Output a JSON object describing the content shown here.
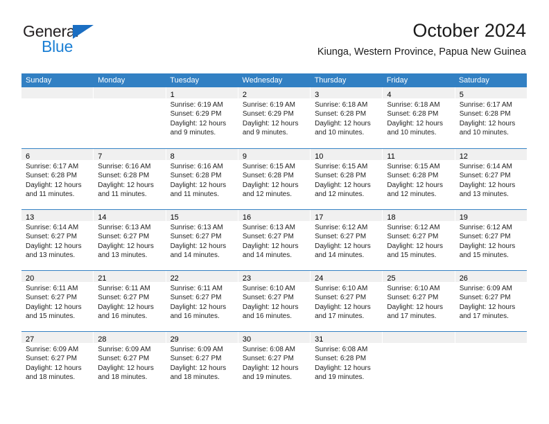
{
  "brand": {
    "name_top": "General",
    "name_bottom": "Blue",
    "triangle_icon": "triangle-icon",
    "color_dark": "#231f20",
    "color_blue": "#1b7fd4"
  },
  "header": {
    "title": "October 2024",
    "subtitle": "Kiunga, Western Province, Papua New Guinea"
  },
  "theme": {
    "header_bg": "#3280c3",
    "header_text": "#ffffff",
    "daynum_band": "#f0f0f0",
    "grid_line": "#3280c3"
  },
  "weekdays": [
    "Sunday",
    "Monday",
    "Tuesday",
    "Wednesday",
    "Thursday",
    "Friday",
    "Saturday"
  ],
  "weeks": [
    [
      {
        "day": "",
        "empty": true,
        "lines": []
      },
      {
        "day": "",
        "empty": true,
        "lines": []
      },
      {
        "day": "1",
        "lines": [
          "Sunrise: 6:19 AM",
          "Sunset: 6:29 PM",
          "Daylight: 12 hours",
          "and 9 minutes."
        ]
      },
      {
        "day": "2",
        "lines": [
          "Sunrise: 6:19 AM",
          "Sunset: 6:29 PM",
          "Daylight: 12 hours",
          "and 9 minutes."
        ]
      },
      {
        "day": "3",
        "lines": [
          "Sunrise: 6:18 AM",
          "Sunset: 6:28 PM",
          "Daylight: 12 hours",
          "and 10 minutes."
        ]
      },
      {
        "day": "4",
        "lines": [
          "Sunrise: 6:18 AM",
          "Sunset: 6:28 PM",
          "Daylight: 12 hours",
          "and 10 minutes."
        ]
      },
      {
        "day": "5",
        "lines": [
          "Sunrise: 6:17 AM",
          "Sunset: 6:28 PM",
          "Daylight: 12 hours",
          "and 10 minutes."
        ]
      }
    ],
    [
      {
        "day": "6",
        "lines": [
          "Sunrise: 6:17 AM",
          "Sunset: 6:28 PM",
          "Daylight: 12 hours",
          "and 11 minutes."
        ]
      },
      {
        "day": "7",
        "lines": [
          "Sunrise: 6:16 AM",
          "Sunset: 6:28 PM",
          "Daylight: 12 hours",
          "and 11 minutes."
        ]
      },
      {
        "day": "8",
        "lines": [
          "Sunrise: 6:16 AM",
          "Sunset: 6:28 PM",
          "Daylight: 12 hours",
          "and 11 minutes."
        ]
      },
      {
        "day": "9",
        "lines": [
          "Sunrise: 6:15 AM",
          "Sunset: 6:28 PM",
          "Daylight: 12 hours",
          "and 12 minutes."
        ]
      },
      {
        "day": "10",
        "lines": [
          "Sunrise: 6:15 AM",
          "Sunset: 6:28 PM",
          "Daylight: 12 hours",
          "and 12 minutes."
        ]
      },
      {
        "day": "11",
        "lines": [
          "Sunrise: 6:15 AM",
          "Sunset: 6:28 PM",
          "Daylight: 12 hours",
          "and 12 minutes."
        ]
      },
      {
        "day": "12",
        "lines": [
          "Sunrise: 6:14 AM",
          "Sunset: 6:27 PM",
          "Daylight: 12 hours",
          "and 13 minutes."
        ]
      }
    ],
    [
      {
        "day": "13",
        "lines": [
          "Sunrise: 6:14 AM",
          "Sunset: 6:27 PM",
          "Daylight: 12 hours",
          "and 13 minutes."
        ]
      },
      {
        "day": "14",
        "lines": [
          "Sunrise: 6:13 AM",
          "Sunset: 6:27 PM",
          "Daylight: 12 hours",
          "and 13 minutes."
        ]
      },
      {
        "day": "15",
        "lines": [
          "Sunrise: 6:13 AM",
          "Sunset: 6:27 PM",
          "Daylight: 12 hours",
          "and 14 minutes."
        ]
      },
      {
        "day": "16",
        "lines": [
          "Sunrise: 6:13 AM",
          "Sunset: 6:27 PM",
          "Daylight: 12 hours",
          "and 14 minutes."
        ]
      },
      {
        "day": "17",
        "lines": [
          "Sunrise: 6:12 AM",
          "Sunset: 6:27 PM",
          "Daylight: 12 hours",
          "and 14 minutes."
        ]
      },
      {
        "day": "18",
        "lines": [
          "Sunrise: 6:12 AM",
          "Sunset: 6:27 PM",
          "Daylight: 12 hours",
          "and 15 minutes."
        ]
      },
      {
        "day": "19",
        "lines": [
          "Sunrise: 6:12 AM",
          "Sunset: 6:27 PM",
          "Daylight: 12 hours",
          "and 15 minutes."
        ]
      }
    ],
    [
      {
        "day": "20",
        "lines": [
          "Sunrise: 6:11 AM",
          "Sunset: 6:27 PM",
          "Daylight: 12 hours",
          "and 15 minutes."
        ]
      },
      {
        "day": "21",
        "lines": [
          "Sunrise: 6:11 AM",
          "Sunset: 6:27 PM",
          "Daylight: 12 hours",
          "and 16 minutes."
        ]
      },
      {
        "day": "22",
        "lines": [
          "Sunrise: 6:11 AM",
          "Sunset: 6:27 PM",
          "Daylight: 12 hours",
          "and 16 minutes."
        ]
      },
      {
        "day": "23",
        "lines": [
          "Sunrise: 6:10 AM",
          "Sunset: 6:27 PM",
          "Daylight: 12 hours",
          "and 16 minutes."
        ]
      },
      {
        "day": "24",
        "lines": [
          "Sunrise: 6:10 AM",
          "Sunset: 6:27 PM",
          "Daylight: 12 hours",
          "and 17 minutes."
        ]
      },
      {
        "day": "25",
        "lines": [
          "Sunrise: 6:10 AM",
          "Sunset: 6:27 PM",
          "Daylight: 12 hours",
          "and 17 minutes."
        ]
      },
      {
        "day": "26",
        "lines": [
          "Sunrise: 6:09 AM",
          "Sunset: 6:27 PM",
          "Daylight: 12 hours",
          "and 17 minutes."
        ]
      }
    ],
    [
      {
        "day": "27",
        "lines": [
          "Sunrise: 6:09 AM",
          "Sunset: 6:27 PM",
          "Daylight: 12 hours",
          "and 18 minutes."
        ]
      },
      {
        "day": "28",
        "lines": [
          "Sunrise: 6:09 AM",
          "Sunset: 6:27 PM",
          "Daylight: 12 hours",
          "and 18 minutes."
        ]
      },
      {
        "day": "29",
        "lines": [
          "Sunrise: 6:09 AM",
          "Sunset: 6:27 PM",
          "Daylight: 12 hours",
          "and 18 minutes."
        ]
      },
      {
        "day": "30",
        "lines": [
          "Sunrise: 6:08 AM",
          "Sunset: 6:27 PM",
          "Daylight: 12 hours",
          "and 19 minutes."
        ]
      },
      {
        "day": "31",
        "lines": [
          "Sunrise: 6:08 AM",
          "Sunset: 6:28 PM",
          "Daylight: 12 hours",
          "and 19 minutes."
        ]
      },
      {
        "day": "",
        "empty": true,
        "lines": []
      },
      {
        "day": "",
        "empty": true,
        "lines": []
      }
    ]
  ]
}
